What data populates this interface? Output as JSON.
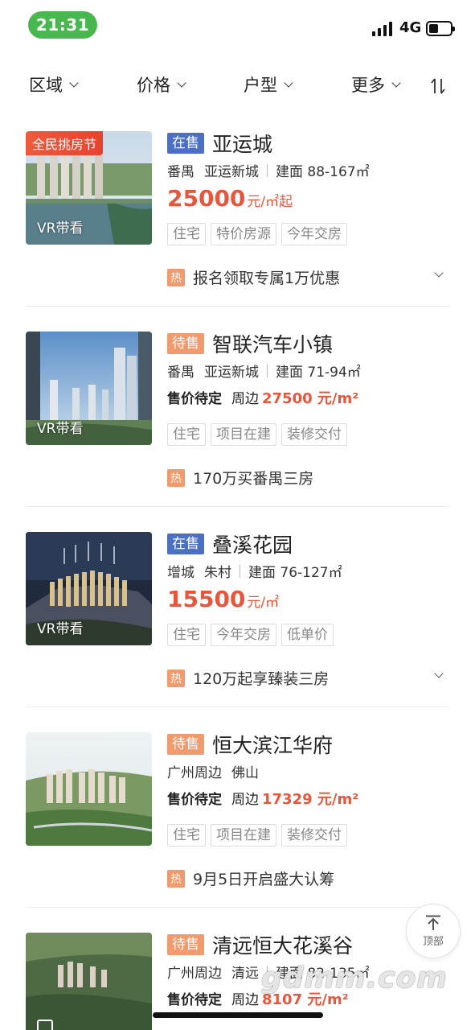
{
  "status_bar": {
    "time": "21:31",
    "network": "4G"
  },
  "filters": [
    {
      "label": "区域"
    },
    {
      "label": "价格"
    },
    {
      "label": "户型"
    },
    {
      "label": "更多"
    }
  ],
  "listings": [
    {
      "status": "在售",
      "name": "亚运城",
      "district": "番禺",
      "area": "亚运新城",
      "build_area": "建面 88-167㎡",
      "price": "25000",
      "price_unit": "元/㎡起",
      "promo": "全民挑房节",
      "vr": "VR带看",
      "tags": [
        "住宅",
        "特价房源",
        "今年交房"
      ],
      "hot_label": "热",
      "hot_text": "报名领取专属1万优惠"
    },
    {
      "status": "待售",
      "name": "智联汽车小镇",
      "district": "番禺",
      "area": "亚运新城",
      "build_area": "建面 71-94㎡",
      "price_label": "售价待定",
      "near_label": "周边",
      "near_price": "27500 元/m²",
      "vr": "VR带看",
      "tags": [
        "住宅",
        "项目在建",
        "装修交付"
      ],
      "hot_label": "热",
      "hot_text": "170万买番禺三房"
    },
    {
      "status": "在售",
      "name": "叠溪花园",
      "district": "增城",
      "area": "朱村",
      "build_area": "建面 76-127㎡",
      "price": "15500",
      "price_unit": "元/㎡",
      "vr": "VR带看",
      "tags": [
        "住宅",
        "今年交房",
        "低单价"
      ],
      "hot_label": "热",
      "hot_text": "120万起享臻装三房"
    },
    {
      "status": "待售",
      "name": "恒大滨江华府",
      "district": "广州周边",
      "area": "佛山",
      "price_label": "售价待定",
      "near_label": "周边",
      "near_price": "17329 元/m²",
      "tags": [
        "住宅",
        "项目在建",
        "装修交付"
      ],
      "hot_label": "热",
      "hot_text": "9月5日开启盛大认筹"
    },
    {
      "status": "待售",
      "name": "清远恒大花溪谷",
      "district": "广州周边",
      "area": "清远",
      "build_area": "建面 82-135㎡",
      "price_label": "售价待定",
      "near_label": "周边",
      "near_price": "8107 元/m²"
    }
  ],
  "top_button": {
    "label": "顶部"
  },
  "watermark": "gdmm.com",
  "colors": {
    "accent": "#e9553a",
    "on_sale": "#4b6fc1",
    "pending": "#f09a6e",
    "time_pill": "#48b74f"
  }
}
